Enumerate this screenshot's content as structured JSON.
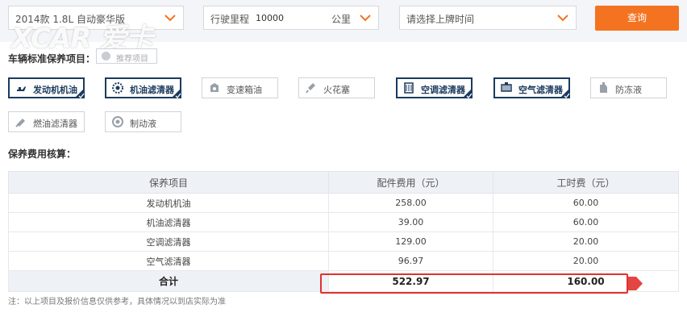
{
  "filters": {
    "model": "2014款 1.8L 自动豪华版",
    "mileage_label": "行驶里程",
    "mileage_value": "10000",
    "mileage_unit": "公里",
    "date_placeholder": "请选择上牌时间",
    "query_button": "查询"
  },
  "watermark": "XCAR 爱卡",
  "standard_section": {
    "title": "车辆标准保养项目：",
    "recommended_label": "推荐项目",
    "items": [
      {
        "label": "发动机机油",
        "selected": true,
        "icon": "oil-can-icon"
      },
      {
        "label": "机油滤清器",
        "selected": true,
        "icon": "oil-filter-icon"
      },
      {
        "label": "变速箱油",
        "selected": false,
        "icon": "gearbox-oil-icon"
      },
      {
        "label": "火花塞",
        "selected": false,
        "icon": "spark-plug-icon"
      },
      {
        "label": "空调滤清器",
        "selected": true,
        "icon": "ac-filter-icon"
      },
      {
        "label": "空气滤清器",
        "selected": true,
        "icon": "air-filter-icon"
      },
      {
        "label": "防冻液",
        "selected": false,
        "icon": "antifreeze-icon"
      },
      {
        "label": "燃油滤清器",
        "selected": false,
        "icon": "fuel-filter-icon"
      },
      {
        "label": "制动液",
        "selected": false,
        "icon": "brake-fluid-icon"
      }
    ]
  },
  "cost_section": {
    "title": "保养费用核算：",
    "headers": [
      "保养项目",
      "配件费用（元）",
      "工时费（元）"
    ],
    "rows": [
      [
        "发动机机油",
        "258.00",
        "60.00"
      ],
      [
        "机油滤清器",
        "39.00",
        "60.00"
      ],
      [
        "空调滤清器",
        "129.00",
        "20.00"
      ],
      [
        "空气滤清器",
        "96.97",
        "20.00"
      ]
    ],
    "total": [
      "合计",
      "522.97",
      "160.00"
    ]
  },
  "note": "注：以上项目及报价信息仅供参考，具体情况以到店实际为准",
  "colors": {
    "accent": "#f47321",
    "selected": "#1b3a5e",
    "highlight": "#e0322e"
  }
}
